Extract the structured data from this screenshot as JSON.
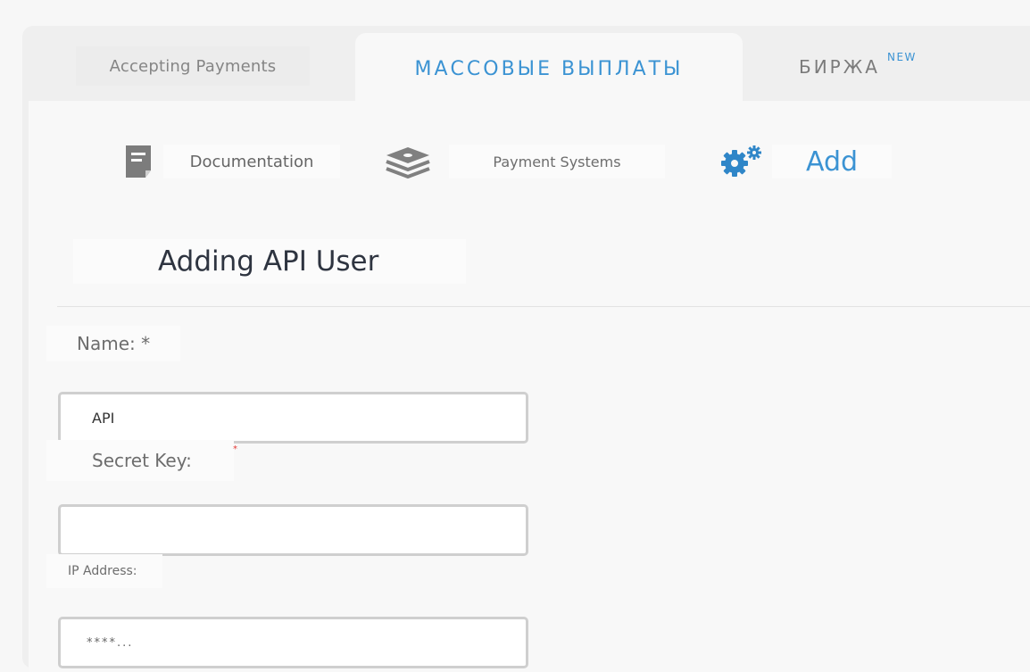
{
  "tabs": {
    "accepting": "Accepting Payments",
    "mass_payouts": "МАССОВЫЕ ВЫПЛАТЫ",
    "exchange": "БИРЖА",
    "exchange_badge": "NEW"
  },
  "subnav": {
    "documentation": {
      "label": "Documentation",
      "icon": "document-icon"
    },
    "payment_systems": {
      "label": "Payment Systems",
      "icon": "layers-icon"
    },
    "add": {
      "label": "Add",
      "icon": "gears-icon"
    }
  },
  "form": {
    "title": "Adding API User",
    "name_label": "Name: *",
    "name_value": "API",
    "secret_label": "Secret Key:",
    "secret_required_mark": "*",
    "secret_value": "",
    "ip_label": "IP Address:",
    "ip_value": "****..."
  },
  "colors": {
    "accent": "#3b93d3",
    "required": "#e53935",
    "input_border": "#cfcfcf"
  }
}
